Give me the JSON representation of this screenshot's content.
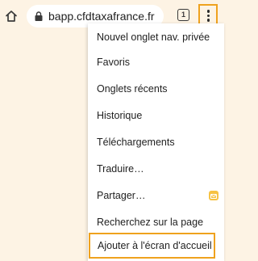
{
  "toolbar": {
    "home_icon": "home-icon",
    "lock_icon": "lock-icon",
    "url": "bapp.cfdtaxafrance.fr",
    "tab_count": "1",
    "more_icon": "more-vert-icon"
  },
  "menu": {
    "items": [
      {
        "label": "Nouvel onglet nav. privée"
      },
      {
        "label": "Favoris"
      },
      {
        "label": "Onglets récents"
      },
      {
        "label": "Historique"
      },
      {
        "label": "Téléchargements"
      },
      {
        "label": "Traduire…"
      },
      {
        "label": "Partager…",
        "badge_icon": "share-app-icon"
      },
      {
        "label": "Recherchez sur la page"
      },
      {
        "label": "Ajouter à l'écran d'accueil"
      }
    ]
  },
  "colors": {
    "background": "#fdf3e4",
    "highlight": "#efa21e",
    "menu_background": "#ffffff",
    "badge": "#f6c243"
  }
}
